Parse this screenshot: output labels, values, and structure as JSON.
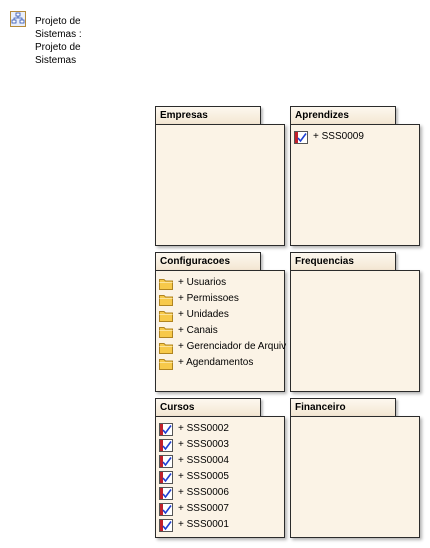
{
  "project": {
    "title": "Projeto de\nSistemas :\nProjeto de\nSistemas",
    "icon": "package-diagram-icon"
  },
  "colors": {
    "package_fill": "#fbf3e6",
    "tab_fill": "#f3e6d2",
    "border": "#2b2b2b",
    "folder": "#f7c94a",
    "checkbox_check": "#1f3fd1",
    "checkbox_mark": "#c0202a"
  },
  "packages": {
    "empresas": {
      "title": "Empresas",
      "items": []
    },
    "aprendizes": {
      "title": "Aprendizes",
      "items": [
        "+ SSS0009"
      ]
    },
    "configuracoes": {
      "title": "Configuracoes",
      "items": [
        "+ Usuarios",
        "+ Permissoes",
        "+ Unidades",
        "+ Canais",
        "+ Gerenciador de Arquiv",
        "+ Agendamentos"
      ]
    },
    "frequencias": {
      "title": "Frequencias",
      "items": []
    },
    "cursos": {
      "title": "Cursos",
      "items": [
        "+ SSS0002",
        "+ SSS0003",
        "+ SSS0004",
        "+ SSS0005",
        "+ SSS0006",
        "+ SSS0007",
        "+ SSS0001"
      ]
    },
    "financeiro": {
      "title": "Financeiro",
      "items": []
    }
  }
}
